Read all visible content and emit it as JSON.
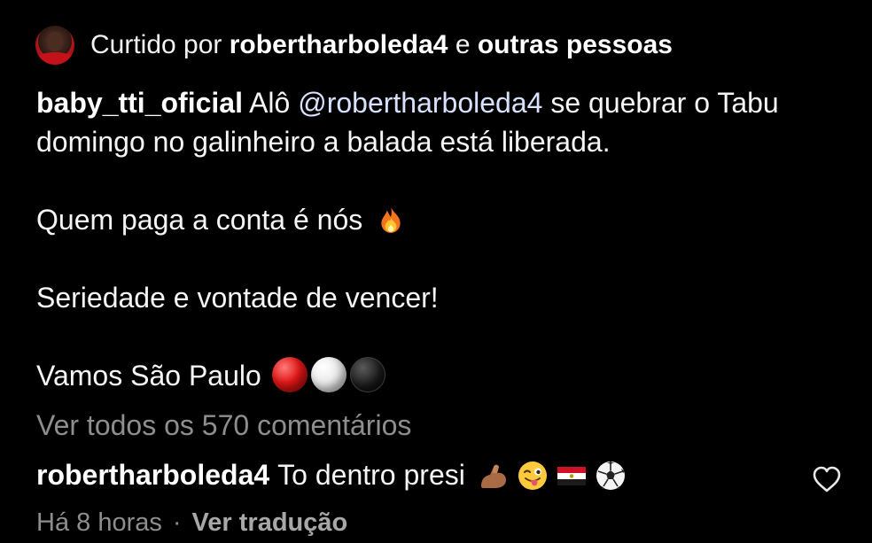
{
  "likes": {
    "prefix": "Curtido por",
    "user": "robertharboleda4",
    "connector": "e",
    "others": "outras pessoas"
  },
  "caption": {
    "username": "baby_tti_oficial",
    "line1_before": "Alô",
    "mention": "@robertharboleda4",
    "line1_after": "se quebrar o Tabu domingo no galinheiro a balada está liberada.",
    "line2": "Quem paga a conta é nós",
    "line3": "Seriedade e vontade de vencer!",
    "line4": "Vamos São Paulo"
  },
  "view_all_comments": "Ver todos os 570 comentários",
  "comment": {
    "username": "robertharboleda4",
    "text": "To dentro presi"
  },
  "comment_meta": {
    "time": "Há 8 horas",
    "separator": "·",
    "translate": "Ver tradução"
  },
  "icons": {
    "caption_emoji": "fire-icon",
    "team_balls": [
      "red-circle-icon",
      "white-circle-icon",
      "black-circle-icon"
    ],
    "comment_emojis": [
      "flexed-biceps-icon",
      "winking-tongue-face-icon",
      "egypt-flag-icon",
      "soccer-ball-icon"
    ],
    "like": "heart-outline-icon"
  },
  "colors": {
    "background": "#000000",
    "text": "#f5f5f5",
    "secondary": "#8e8e8e",
    "mention": "#d8e2ff"
  }
}
